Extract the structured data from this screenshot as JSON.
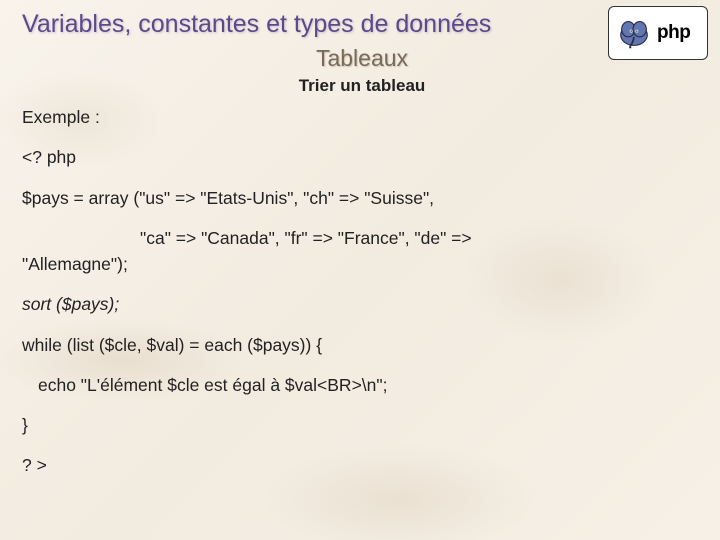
{
  "logo": {
    "text": "php",
    "icon": "elephant-icon"
  },
  "title": "Variables, constantes et types de données",
  "subtitle": "Tableaux",
  "section_title": "Trier un tableau",
  "code": {
    "example_label": "Exemple :",
    "open_tag": "<? php",
    "array_line1": "$pays = array (\"us\" => \"Etats-Unis\", \"ch\" => \"Suisse\",",
    "array_line2a": "\"ca\" => \"Canada\", \"fr\" => \"France\", \"de\" =>",
    "array_line2b": "\"Allemagne\");",
    "sort_line": "sort ($pays);",
    "while_line": "while (list ($cle, $val) = each ($pays)) {",
    "echo_line": "echo \"L'élément $cle est égal à $val<BR>\\n\";",
    "close_brace": "}",
    "close_tag": "? >"
  }
}
